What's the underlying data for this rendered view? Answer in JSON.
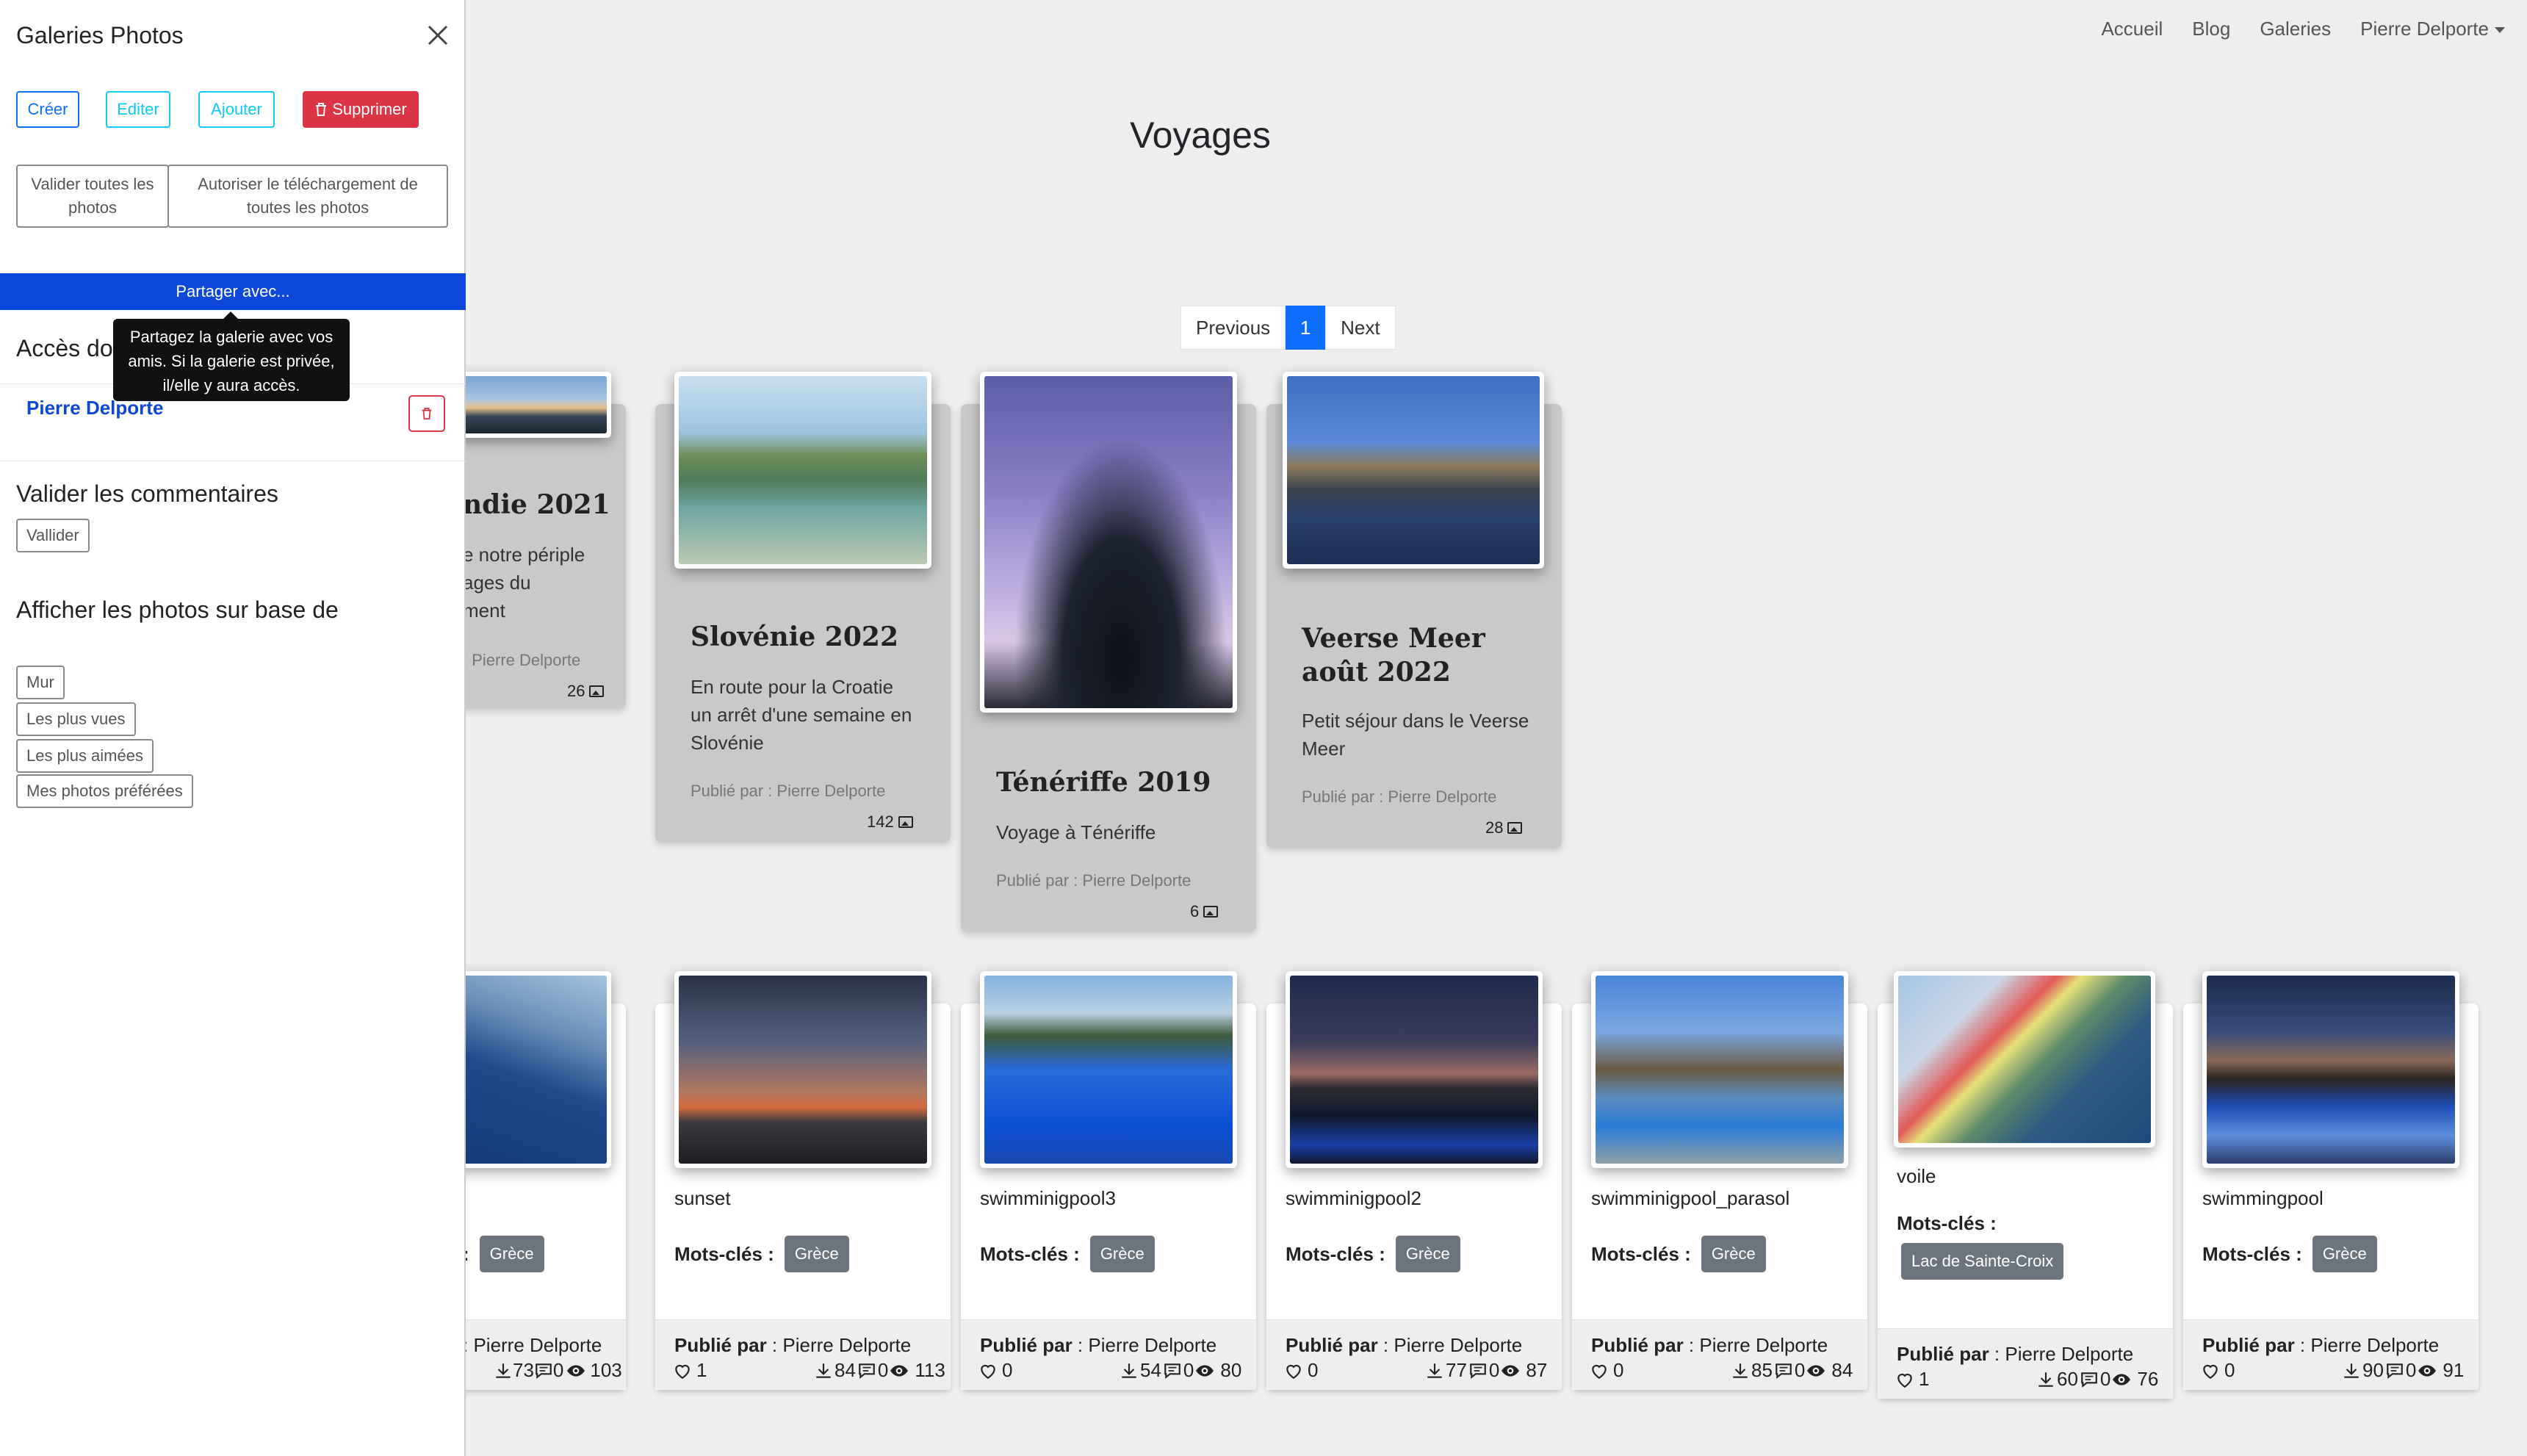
{
  "nav": {
    "home": "Accueil",
    "blog": "Blog",
    "galleries": "Galeries",
    "user": "Pierre Delporte"
  },
  "page_title": "Voyages",
  "pagination": {
    "previous": "Previous",
    "current": "1",
    "next": "Next"
  },
  "sidebar": {
    "title": "Galeries Photos",
    "buttons": {
      "create": "Créer",
      "edit": "Editer",
      "add": "Ajouter",
      "delete": "Supprimer"
    },
    "validate_all": "Valider toutes les photos",
    "allow_download": "Autoriser le téléchargement de toutes les photos",
    "share": "Partager avec...",
    "tooltip": "Partagez la galerie avec vos amis. Si la galerie est privée, il/elle y aura accès.",
    "access_heading": "Accès do",
    "access_user": "Pierre Delporte",
    "comments_heading": "Valider les commentaires",
    "comments_button": "Vallider",
    "display_heading": "Afficher les photos sur base de",
    "display_options": [
      "Mur",
      "Les plus vues",
      "Les plus aimées",
      "Mes photos préférées"
    ]
  },
  "galleries": [
    {
      "title": "ndie 2021",
      "desc": [
        "e notre périple",
        "ages du",
        "ment"
      ],
      "author": ": Pierre Delporte",
      "count": "26"
    },
    {
      "title": "Slovénie 2022",
      "desc": [
        "En route pour la Croatie",
        "un arrêt d'une semaine en",
        "Slovénie"
      ],
      "author": "Publié par : Pierre Delporte",
      "count": "142"
    },
    {
      "title": "Ténériffe 2019",
      "desc": [
        "Voyage à Ténériffe"
      ],
      "author": "Publié par : Pierre Delporte",
      "count": "6"
    },
    {
      "title": "Veerse Meer août 2022",
      "desc": [
        "Petit séjour dans le Veerse",
        "Meer"
      ],
      "author": "Publié par : Pierre Delporte",
      "count": "28"
    }
  ],
  "photos": [
    {
      "name": "",
      "kw_label": ":",
      "keyword": "Grèce",
      "pub_label": "",
      "pub_name": ": Pierre Delporte",
      "likes": "",
      "downloads": "73",
      "comments": "0",
      "views": "103"
    },
    {
      "name": "sunset",
      "kw_label": "Mots-clés :",
      "keyword": "Grèce",
      "pub_label": "Publié par",
      "pub_name": " : Pierre Delporte",
      "likes": "1",
      "downloads": "84",
      "comments": "0",
      "views": "113"
    },
    {
      "name": "swimminigpool3",
      "kw_label": "Mots-clés :",
      "keyword": "Grèce",
      "pub_label": "Publié par",
      "pub_name": " : Pierre Delporte",
      "likes": "0",
      "downloads": "54",
      "comments": "0",
      "views": "80"
    },
    {
      "name": "swimminigpool2",
      "kw_label": "Mots-clés :",
      "keyword": "Grèce",
      "pub_label": "Publié par",
      "pub_name": " : Pierre Delporte",
      "likes": "0",
      "downloads": "77",
      "comments": "0",
      "views": "87"
    },
    {
      "name": "swimminigpool_parasol",
      "kw_label": "Mots-clés :",
      "keyword": "Grèce",
      "pub_label": "Publié par",
      "pub_name": " : Pierre Delporte",
      "likes": "0",
      "downloads": "85",
      "comments": "0",
      "views": "84"
    },
    {
      "name": "voile",
      "kw_label": "Mots-clés :",
      "keyword": "Lac de Sainte-Croix",
      "pub_label": "Publié par",
      "pub_name": " : Pierre Delporte",
      "likes": "1",
      "downloads": "60",
      "comments": "0",
      "views": "76"
    },
    {
      "name": "swimmingpool",
      "kw_label": "Mots-clés :",
      "keyword": "Grèce",
      "pub_label": "Publié par",
      "pub_name": " : Pierre Delporte",
      "likes": "0",
      "downloads": "90",
      "comments": "0",
      "views": "91"
    }
  ],
  "colors": {
    "primary": "#0d6efd",
    "danger": "#dc3545",
    "share_bar": "#0d47d9",
    "badge": "#6c757d",
    "gallery_card": "#c9c9c9"
  }
}
